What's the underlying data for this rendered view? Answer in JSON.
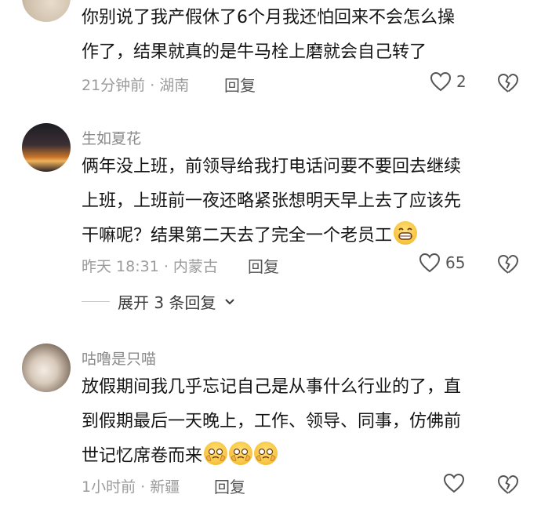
{
  "comments": [
    {
      "username": "",
      "text_lines": [
        "你别说了我产假休了6个月我还怕回来不会怎么操",
        "作了，结果就真的是牛马栓上磨就会自己转了"
      ],
      "meta": "21分钟前 · 湖南",
      "reply_label": "回复",
      "likes": "2",
      "emojis": 0
    },
    {
      "username": "生如夏花",
      "text_lines": [
        "俩年没上班，前领导给我打电话问要不要回去继续",
        "上班，上班前一夜还略紧张想明天早上去了应该先",
        "干嘛呢？结果第二天去了完全一个老员工"
      ],
      "meta": "昨天 18:31 · 内蒙古",
      "reply_label": "回复",
      "likes": "65",
      "emojis": 1,
      "expand_label": "展开 3 条回复"
    },
    {
      "username": "咕噜是只喵",
      "text_lines": [
        "放假期间我几乎忘记自己是从事什么行业的了，直",
        "到假期最后一天晚上，工作、领导、同事，仿佛前",
        "世记忆席卷而来"
      ],
      "meta": "1小时前 · 新疆",
      "reply_label": "回复",
      "likes": "",
      "emojis": 3
    }
  ],
  "colors": {
    "text": "#151515",
    "meta": "#9b9b9b",
    "username": "#8a8a8a",
    "icon": "#555555"
  },
  "icons": [
    "heart-outline-icon",
    "broken-heart-icon",
    "chevron-down-icon",
    "grin-emoji",
    "crying-pleading-emoji"
  ]
}
